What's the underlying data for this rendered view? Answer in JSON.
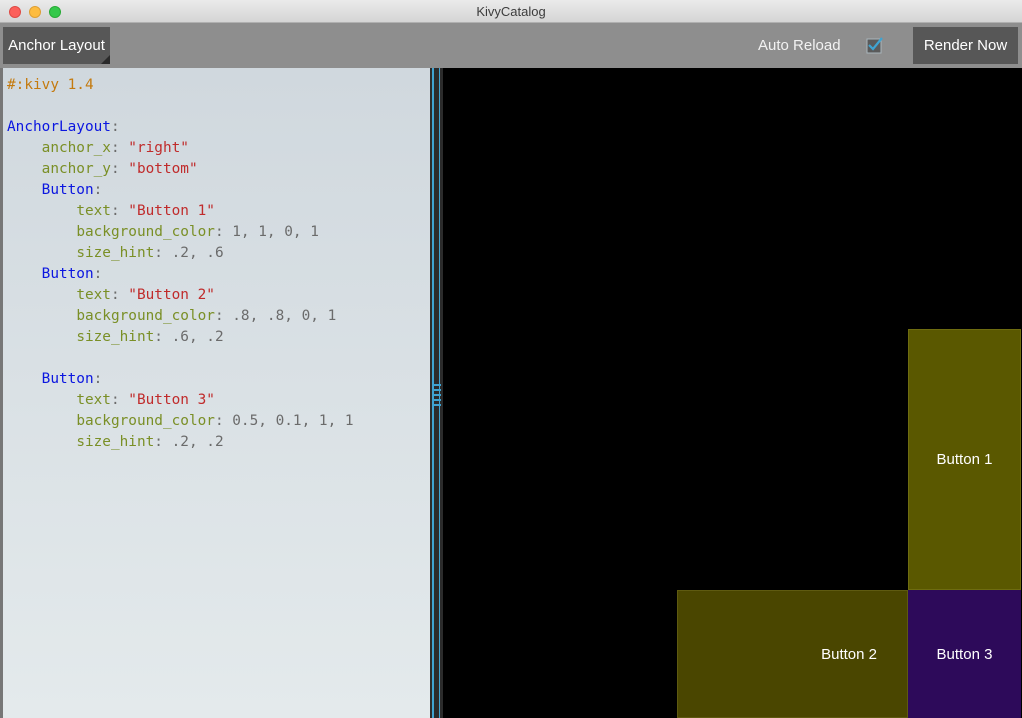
{
  "window": {
    "title": "KivyCatalog"
  },
  "toolbar": {
    "layout_button": "Anchor Layout",
    "auto_reload_label": "Auto Reload",
    "auto_reload_checked": true,
    "render_button": "Render Now"
  },
  "editor": {
    "lines": [
      [
        [
          "#:kivy 1.4",
          "comment"
        ]
      ],
      [],
      [
        [
          "AnchorLayout",
          "class"
        ],
        [
          ":",
          "plain"
        ]
      ],
      [
        [
          "    ",
          "plain"
        ],
        [
          "anchor_x",
          "prop"
        ],
        [
          ": ",
          "plain"
        ],
        [
          "\"right\"",
          "string"
        ]
      ],
      [
        [
          "    ",
          "plain"
        ],
        [
          "anchor_y",
          "prop"
        ],
        [
          ": ",
          "plain"
        ],
        [
          "\"bottom\"",
          "string"
        ]
      ],
      [
        [
          "    ",
          "plain"
        ],
        [
          "Button",
          "class"
        ],
        [
          ":",
          "plain"
        ]
      ],
      [
        [
          "        ",
          "plain"
        ],
        [
          "text",
          "prop"
        ],
        [
          ": ",
          "plain"
        ],
        [
          "\"Button 1\"",
          "string"
        ]
      ],
      [
        [
          "        ",
          "plain"
        ],
        [
          "background_color",
          "prop"
        ],
        [
          ": 1, 1, 0, 1",
          "plain"
        ]
      ],
      [
        [
          "        ",
          "plain"
        ],
        [
          "size_hint",
          "prop"
        ],
        [
          ": .2, .6",
          "plain"
        ]
      ],
      [
        [
          "    ",
          "plain"
        ],
        [
          "Button",
          "class"
        ],
        [
          ":",
          "plain"
        ]
      ],
      [
        [
          "        ",
          "plain"
        ],
        [
          "text",
          "prop"
        ],
        [
          ": ",
          "plain"
        ],
        [
          "\"Button 2\"",
          "string"
        ]
      ],
      [
        [
          "        ",
          "plain"
        ],
        [
          "background_color",
          "prop"
        ],
        [
          ": .8, .8, 0, 1",
          "plain"
        ]
      ],
      [
        [
          "        ",
          "plain"
        ],
        [
          "size_hint",
          "prop"
        ],
        [
          ": .6, .2",
          "plain"
        ]
      ],
      [],
      [
        [
          "    ",
          "plain"
        ],
        [
          "Button",
          "class"
        ],
        [
          ":",
          "plain"
        ]
      ],
      [
        [
          "        ",
          "plain"
        ],
        [
          "text",
          "prop"
        ],
        [
          ": ",
          "plain"
        ],
        [
          "\"Button 3\"",
          "string"
        ]
      ],
      [
        [
          "        ",
          "plain"
        ],
        [
          "background_color",
          "prop"
        ],
        [
          ": 0.5, 0.1, 1, 1",
          "plain"
        ]
      ],
      [
        [
          "        ",
          "plain"
        ],
        [
          "size_hint",
          "prop"
        ],
        [
          ": .2, .2",
          "plain"
        ]
      ]
    ]
  },
  "preview": {
    "buttons": [
      {
        "label": "Button 1"
      },
      {
        "label": "Button 2"
      },
      {
        "label": "Button 3"
      }
    ]
  },
  "colors": {
    "accent": "#3fa3d1",
    "toolbar_bg": "#8e8e8e",
    "button_bg": "#575757"
  }
}
